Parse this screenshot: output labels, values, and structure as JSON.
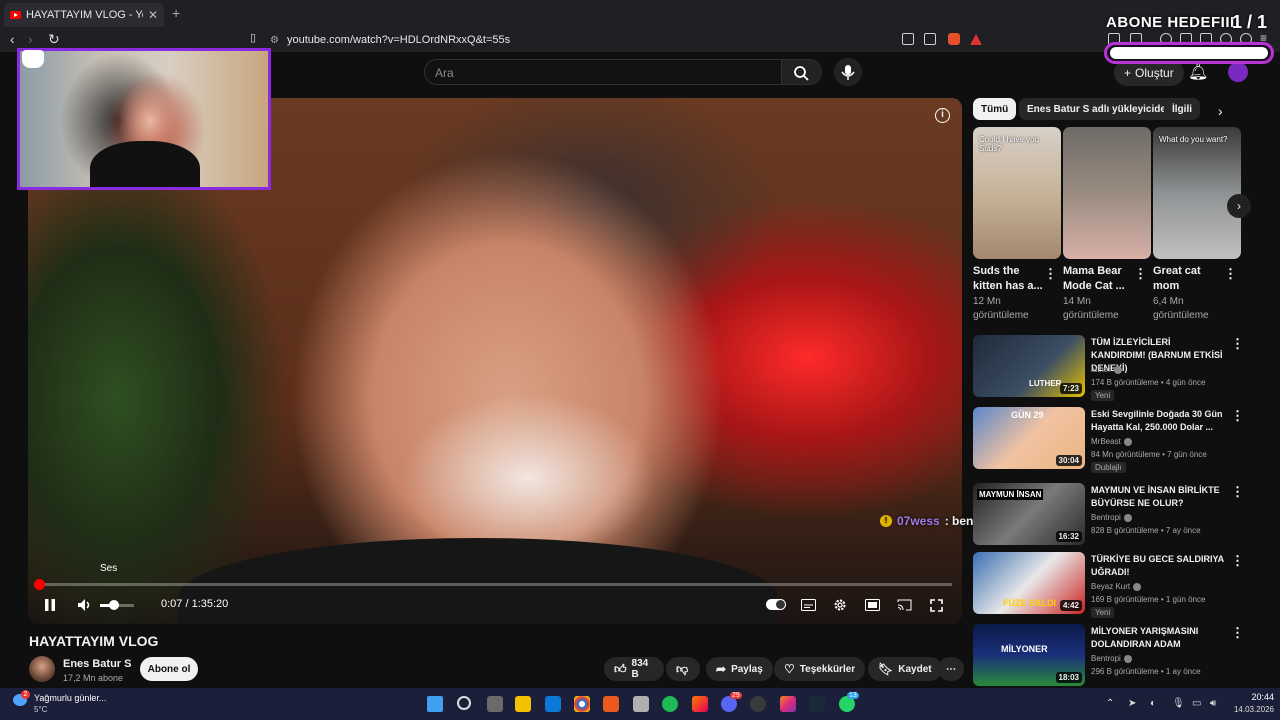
{
  "browser": {
    "tab_title": "HAYATTAYIM VLOG - YouTube",
    "url": "youtube.com/watch?v=HDLOrdNRxxQ&t=55s"
  },
  "overlay": {
    "abone_label": "ABONE HEDEFIII",
    "abone_count": "1 / 1",
    "abone_progress": 1.0,
    "chat_user": "07wess",
    "chat_message": ": bende öyle",
    "accent": "#8a2be2"
  },
  "header": {
    "search_placeholder": "Ara",
    "create_label": "Oluştur"
  },
  "player": {
    "tooltip": "Ses",
    "time": "0:07 / 1:35:20",
    "played_fraction": 0.0012,
    "volume_fraction": 0.4
  },
  "video": {
    "title": "HAYATTAYIM VLOG",
    "channel": "Enes Batur S",
    "subscribers": "17,2 Mn abone",
    "subscribe_label": "Abone ol",
    "likes": "834 B",
    "share_label": "Paylaş",
    "thanks_label": "Teşekkürler",
    "save_label": "Kaydet"
  },
  "sidebar": {
    "chips": [
      "Tümü",
      "Enes Batur S adlı yükleyiciden",
      "İlgili"
    ],
    "shorts": [
      {
        "title": "Suds the kitten has a...",
        "views": "12 Mn görüntüleme",
        "caption": "Could I have you Suds?"
      },
      {
        "title": "Mama Bear Mode Cat ...",
        "views": "14 Mn görüntüleme",
        "caption": ""
      },
      {
        "title": "Great cat mom",
        "views": "6,4 Mn görüntüleme",
        "caption": "What do you want?"
      }
    ],
    "recommended": [
      {
        "title": "TÜM İZLEYİCİLERİ KANDIRDIM! (BARNUM ETKİSİ DENEYİ)",
        "channel": "luther",
        "meta": "174 B görüntüleme • 4 gün önce",
        "badge": "Yeni",
        "duration": "7:23",
        "thumb_text": "LUTHER"
      },
      {
        "title": "Eski Sevgilinle Doğada 30 Gün Hayatta Kal, 250.000 Dolar ...",
        "channel": "MrBeast",
        "meta": "84 Mn görüntüleme • 7 gün önce",
        "badge": "Dublajlı",
        "duration": "30:04",
        "thumb_text": "GÜN 29"
      },
      {
        "title": "MAYMUN VE İNSAN BİRLİKTE BÜYÜRSE NE OLUR?",
        "channel": "Bentropi",
        "meta": "828 B görüntüleme • 7 ay önce",
        "badge": "",
        "duration": "16:32",
        "thumb_text": "MAYMUN İNSAN"
      },
      {
        "title": "TÜRKİYE BU GECE SALDIRIYA UĞRADI!",
        "channel": "Beyaz Kurt",
        "meta": "169 B görüntüleme • 1 gün önce",
        "badge": "Yeni",
        "duration": "4:42",
        "thumb_text": "FÜZE SALDI"
      },
      {
        "title": "MİLYONER YARIŞMASINI DOLANDIRAN ADAM",
        "channel": "Bentropi",
        "meta": "296 B görüntüleme • 1 ay önce",
        "badge": "",
        "duration": "18:03",
        "thumb_text": "MİLYONER"
      }
    ]
  },
  "taskbar": {
    "weather": "Yağmurlu günler...",
    "temp": "5°C",
    "weather_badge": "2",
    "time": "20:44",
    "date": "14.03.2026",
    "steam_badge": "13",
    "discord_badge": "29"
  }
}
